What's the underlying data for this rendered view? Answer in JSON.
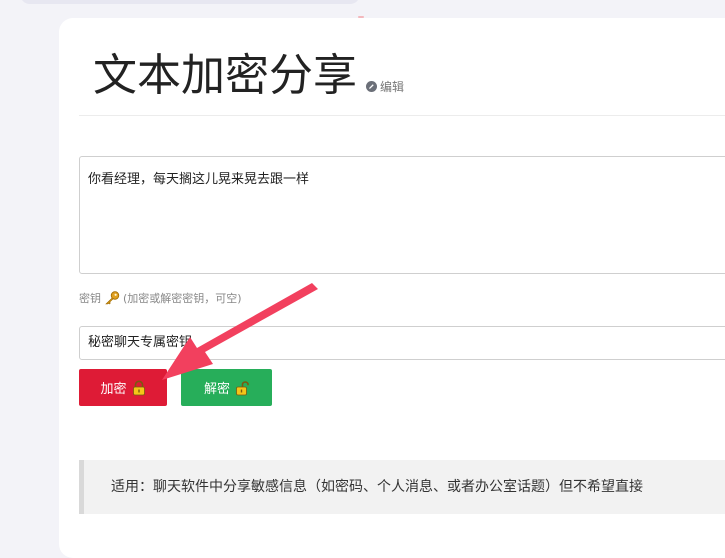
{
  "page": {
    "title": "文本加密分享",
    "edit_label": "编辑"
  },
  "message": {
    "value": "你看经理，每天搁这儿晃来晃去跟一样"
  },
  "key": {
    "label": "密钥",
    "hint": "(加密或解密密钥，可空)",
    "value": "秘密聊天专属密钥"
  },
  "actions": {
    "encrypt_label": "加密",
    "decrypt_label": "解密"
  },
  "note": {
    "text": "适用：聊天软件中分享敏感信息（如密码、个人消息、或者办公室话题）但不希望直接"
  },
  "colors": {
    "encrypt": "#de1b36",
    "decrypt": "#27ae5a",
    "annotation_arrow": "#f2405e"
  },
  "icons": {
    "edit": "pencil-circle-icon",
    "key": "key-icon",
    "encrypt": "lock-closed-icon",
    "decrypt": "lock-open-icon"
  }
}
